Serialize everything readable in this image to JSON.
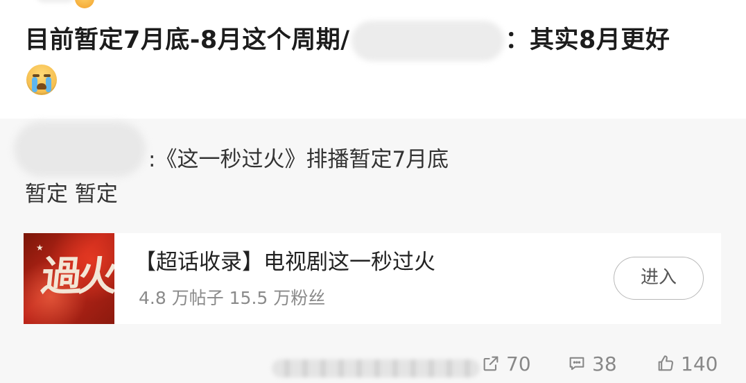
{
  "post": {
    "text_before": "目前暂定7月底-8月这个周期/",
    "text_after": "：其实8月更好",
    "emoji": "crying-face"
  },
  "repost": {
    "quote_text": ":《这一秒过火》排播暂定7月底",
    "line2": "暂定 暂定"
  },
  "topic_card": {
    "title": "【超话收录】电视剧这一秒过火",
    "meta": "4.8 万帖子 15.5 万粉丝",
    "thumb_text": "過火",
    "enter_label": "进入"
  },
  "stats": {
    "reposts": "70",
    "comments": "38",
    "likes": "140"
  },
  "colors": {
    "repost_bg": "#f7f7f7",
    "text_primary": "#1c1c1c",
    "text_muted": "#8a8a8a",
    "thumb_red": "#c0261a"
  }
}
